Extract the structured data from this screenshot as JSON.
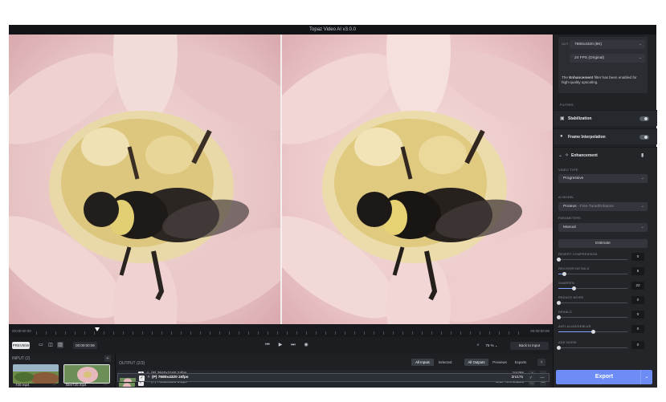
{
  "window": {
    "title": "Topaz Video AI  v3.0.0"
  },
  "timeline": {
    "start_tc": "00:00:00:00",
    "end_tc": "00:00:00:00"
  },
  "controls": {
    "preview_label": "PREVIEW",
    "timecode": "00:00:00:06",
    "zoom": "75 %",
    "back_to_input": "Back to Input"
  },
  "input_panel": {
    "header": "INPUT (2)",
    "add": "+",
    "files": [
      {
        "name": "720.mp4"
      },
      {
        "name": "Bee720.mp4"
      }
    ]
  },
  "output_panel": {
    "header": "OUTPUT (2/3)",
    "filters": [
      "All Inputs",
      "Selected"
    ],
    "views": [
      "All Outputs",
      "Previews",
      "Exports"
    ],
    "help": "?",
    "rows": [
      {
        "info": "(P)  3840x2160  24fps",
        "status": "1m28s"
      },
      {
        "info": "(P)  7680x4320  24fps",
        "status": "User Terminated"
      },
      {
        "info": "(P)  7680x4320  24fps",
        "status": "2m17s"
      }
    ]
  },
  "sidebar": {
    "out_label": "OUT",
    "resolution": "7680x4320 (8K)",
    "fps": "24 FPS (Original)",
    "note_pre": "The ",
    "note_bold": "Enhancement",
    "note_post": " filter has been enabled for high-quality upscaling.",
    "filters_label": "FILTERS",
    "stabilization": "Stabilization",
    "frame_interpolation": "Frame Interpolation",
    "enhancement": "Enhancement",
    "video_type_label": "VIDEO TYPE",
    "video_type": "Progressive",
    "ai_model_label": "AI MODEL",
    "ai_model_name": "Proteus",
    "ai_model_sub": " - Fine-Tune/Enhance",
    "parameters_label": "PARAMETERS",
    "parameters": "Manual",
    "estimate": "Estimate",
    "sliders": [
      {
        "label": "REVERT COMPRESSION",
        "value": "0",
        "fraction": 0.0
      },
      {
        "label": "RECOVER DETAILS",
        "value": "8",
        "fraction": 0.08
      },
      {
        "label": "SHARPEN",
        "value": "22",
        "fraction": 0.22
      },
      {
        "label": "REDUCE NOISE",
        "value": "0",
        "fraction": 0.0
      },
      {
        "label": "DEHALO",
        "value": "0",
        "fraction": 0.0
      },
      {
        "label": "ANTI-ALIAS/DEBLUR",
        "value": "0",
        "fraction": 0.5
      },
      {
        "label": "ADD NOISE",
        "value": "0",
        "fraction": 0.0
      }
    ],
    "export": "Export"
  },
  "colors": {
    "accent": "#6d8cf6",
    "panel": "#202226",
    "petal": "#e9c3c3"
  }
}
